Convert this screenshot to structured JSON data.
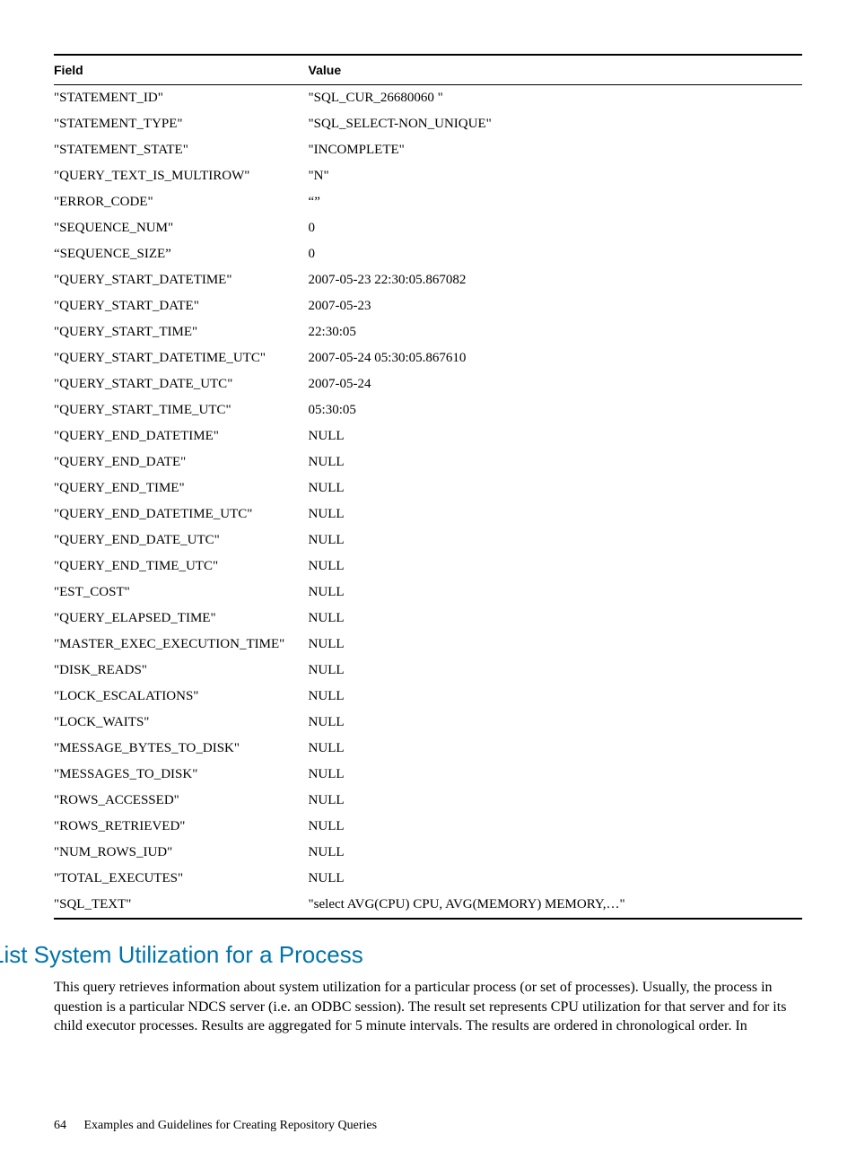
{
  "table": {
    "headers": {
      "field": "Field",
      "value": "Value"
    },
    "rows": [
      {
        "field": "\"STATEMENT_ID\"",
        "value": "\"SQL_CUR_26680060 \""
      },
      {
        "field": "\"STATEMENT_TYPE\"",
        "value": "\"SQL_SELECT-NON_UNIQUE\""
      },
      {
        "field": "\"STATEMENT_STATE\"",
        "value": "\"INCOMPLETE\""
      },
      {
        "field": "\"QUERY_TEXT_IS_MULTIROW\"",
        "value": "\"N\""
      },
      {
        "field": "\"ERROR_CODE\"",
        "value": "“”"
      },
      {
        "field": "\"SEQUENCE_NUM\"",
        "value": "0"
      },
      {
        "field": "“SEQUENCE_SIZE”",
        "value": "0"
      },
      {
        "field": "\"QUERY_START_DATETIME\"",
        "value": "2007-05-23 22:30:05.867082"
      },
      {
        "field": "\"QUERY_START_DATE\"",
        "value": "2007-05-23"
      },
      {
        "field": "\"QUERY_START_TIME\"",
        "value": "22:30:05"
      },
      {
        "field": "\"QUERY_START_DATETIME_UTC\"",
        "value": "2007-05-24 05:30:05.867610"
      },
      {
        "field": "\"QUERY_START_DATE_UTC\"",
        "value": "2007-05-24"
      },
      {
        "field": "\"QUERY_START_TIME_UTC\"",
        "value": "05:30:05"
      },
      {
        "field": "\"QUERY_END_DATETIME\"",
        "value": "NULL"
      },
      {
        "field": "\"QUERY_END_DATE\"",
        "value": "NULL"
      },
      {
        "field": "\"QUERY_END_TIME\"",
        "value": "NULL"
      },
      {
        "field": "\"QUERY_END_DATETIME_UTC\"",
        "value": "NULL"
      },
      {
        "field": "\"QUERY_END_DATE_UTC\"",
        "value": "NULL"
      },
      {
        "field": "\"QUERY_END_TIME_UTC\"",
        "value": "NULL"
      },
      {
        "field": "\"EST_COST\"",
        "value": "NULL"
      },
      {
        "field": "\"QUERY_ELAPSED_TIME\"",
        "value": "NULL"
      },
      {
        "field": "\"MASTER_EXEC_EXECUTION_TIME\"",
        "value": "NULL"
      },
      {
        "field": "\"DISK_READS\"",
        "value": "NULL"
      },
      {
        "field": "\"LOCK_ESCALATIONS\"",
        "value": "NULL"
      },
      {
        "field": "\"LOCK_WAITS\"",
        "value": "NULL"
      },
      {
        "field": "\"MESSAGE_BYTES_TO_DISK\"",
        "value": "NULL"
      },
      {
        "field": "\"MESSAGES_TO_DISK\"",
        "value": "NULL"
      },
      {
        "field": "\"ROWS_ACCESSED\"",
        "value": "NULL"
      },
      {
        "field": "\"ROWS_RETRIEVED\"",
        "value": "NULL"
      },
      {
        "field": "\"NUM_ROWS_IUD\"",
        "value": "NULL"
      },
      {
        "field": "\"TOTAL_EXECUTES\"",
        "value": "NULL"
      },
      {
        "field": "\"SQL_TEXT\"",
        "value": "\"select AVG(CPU) CPU, AVG(MEMORY) MEMORY,…\""
      }
    ]
  },
  "section": {
    "heading": "List System Utilization for a Process",
    "paragraph": "This query retrieves information about system utilization for a particular process (or set of processes). Usually, the process in question is a particular NDCS server (i.e. an ODBC session). The result set represents CPU utilization for that server and for its child executor processes. Results are aggregated for 5 minute intervals. The results are ordered in chronological order. In"
  },
  "footer": {
    "page_number": "64",
    "chapter": "Examples and Guidelines for Creating Repository Queries"
  }
}
